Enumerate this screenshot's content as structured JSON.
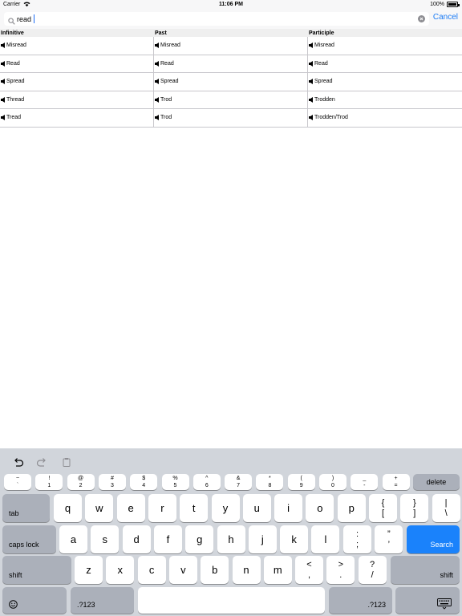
{
  "status_bar": {
    "carrier": "Carrier",
    "time": "11:06 PM",
    "battery": "100%"
  },
  "search": {
    "value": "read",
    "cancel_label": "Cancel"
  },
  "table": {
    "headers": [
      "Infinitive",
      "Past",
      "Participle"
    ],
    "rows": [
      [
        "Misread",
        "Misread",
        "Misread"
      ],
      [
        "Read",
        "Read",
        "Read"
      ],
      [
        "Spread",
        "Spread",
        "Spread"
      ],
      [
        "Thread",
        "Trod",
        "Trodden"
      ],
      [
        "Tread",
        "Trod",
        "Trodden/Trod"
      ]
    ]
  },
  "keyboard": {
    "toolbar_icons": [
      "undo-icon",
      "redo-icon",
      "paste-icon"
    ],
    "number_row": [
      [
        "~",
        "`"
      ],
      [
        "!",
        "1"
      ],
      [
        "@",
        "2"
      ],
      [
        "#",
        "3"
      ],
      [
        "$",
        "4"
      ],
      [
        "%",
        "5"
      ],
      [
        "^",
        "6"
      ],
      [
        "&",
        "7"
      ],
      [
        "*",
        "8"
      ],
      [
        "(",
        "9"
      ],
      [
        ")",
        "0"
      ],
      [
        "_",
        "-"
      ],
      [
        "+",
        "="
      ]
    ],
    "delete_label": "delete",
    "tab_label": "tab",
    "row_q": [
      "q",
      "w",
      "e",
      "r",
      "t",
      "y",
      "u",
      "i",
      "o",
      "p"
    ],
    "row_q_extra": [
      [
        "{",
        "["
      ],
      [
        "}",
        "]"
      ],
      [
        "|",
        "\\"
      ]
    ],
    "caps_label": "caps lock",
    "row_a": [
      "a",
      "s",
      "d",
      "f",
      "g",
      "h",
      "j",
      "k",
      "l"
    ],
    "row_a_extra": [
      [
        ":",
        ";"
      ],
      [
        "”",
        "’"
      ]
    ],
    "search_label": "Search",
    "shift_label": "shift",
    "row_z": [
      "z",
      "x",
      "c",
      "v",
      "b",
      "n",
      "m"
    ],
    "row_z_extra": [
      [
        "<",
        ","
      ],
      [
        ">",
        "."
      ],
      [
        "?",
        "/"
      ]
    ],
    "numbers_label": ".?123",
    "emoji_icon": "emoji-icon",
    "dismiss_icon": "keyboard-dismiss-icon",
    "accent_color": "#1a82fb"
  }
}
